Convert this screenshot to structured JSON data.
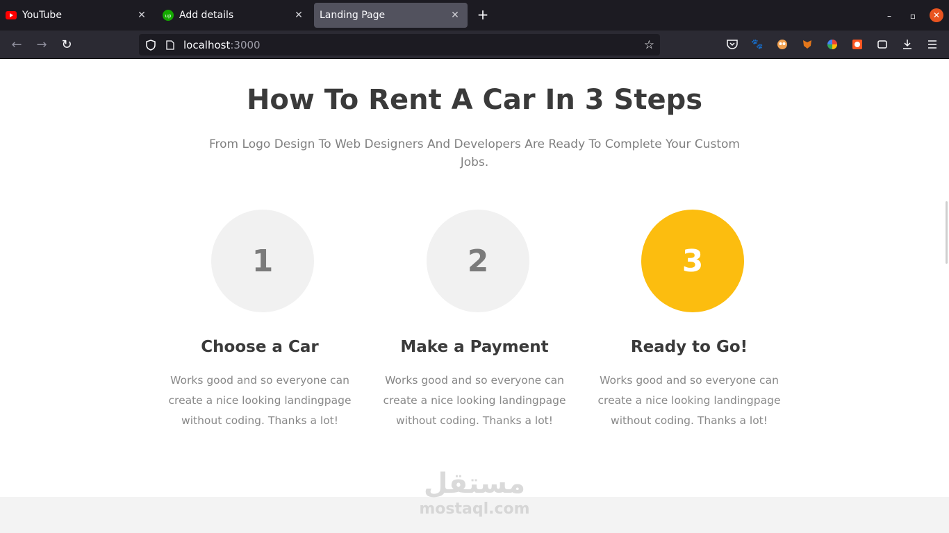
{
  "browser": {
    "tabs": [
      {
        "title": "YouTube",
        "icon": "youtube-icon"
      },
      {
        "title": "Add details",
        "icon": "upwork-icon"
      },
      {
        "title": "Landing Page",
        "icon": ""
      }
    ],
    "url_host": "localhost",
    "url_port": ":3000"
  },
  "page": {
    "heading": "How To Rent A Car In 3 Steps",
    "subheading": "From Logo Design To Web Designers And Developers Are Ready To Complete Your Custom Jobs.",
    "steps": [
      {
        "number": "1",
        "title": "Choose a Car",
        "text": "Works good and so everyone can create a nice looking landingpage without coding. Thanks a lot!"
      },
      {
        "number": "2",
        "title": "Make a Payment",
        "text": "Works good and so everyone can create a nice looking landingpage without coding. Thanks a lot!"
      },
      {
        "number": "3",
        "title": "Ready to Go!",
        "text": "Works good and so everyone can create a nice looking landingpage without coding. Thanks a lot!"
      }
    ],
    "watermark_logo": "مستقل",
    "watermark_site": "mostaql.com"
  },
  "colors": {
    "accent": "#fcbd0f",
    "circle_bg": "#f1f1f1",
    "heading": "#3a3a3a",
    "body_text": "#888888"
  }
}
